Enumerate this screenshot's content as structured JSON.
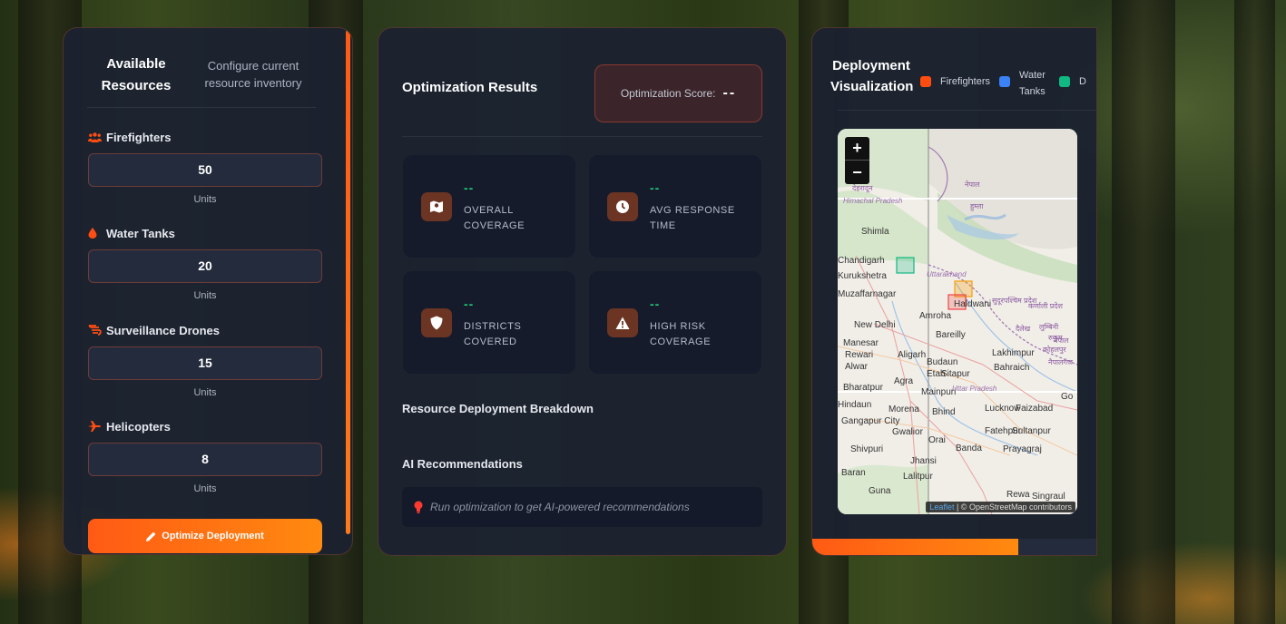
{
  "resources": {
    "title": "Available Resources",
    "subtitle": "Configure current resource inventory",
    "items": [
      {
        "label": "Firefighters",
        "value": "50",
        "unit": "Units",
        "icon": "people-icon"
      },
      {
        "label": "Water Tanks",
        "value": "20",
        "unit": "Units",
        "icon": "droplet-icon"
      },
      {
        "label": "Surveillance Drones",
        "value": "15",
        "unit": "Units",
        "icon": "drone-icon"
      },
      {
        "label": "Helicopters",
        "value": "8",
        "unit": "Units",
        "icon": "plane-icon"
      }
    ],
    "optimize_label": "Optimize Deployment"
  },
  "results": {
    "title": "Optimization Results",
    "score_label": "Optimization Score:",
    "score_value": "--",
    "stats": [
      {
        "value": "--",
        "label": "Overall Coverage",
        "icon": "map-icon"
      },
      {
        "value": "--",
        "label": "Avg Response Time",
        "icon": "clock-icon"
      },
      {
        "value": "--",
        "label": "Districts Covered",
        "icon": "shield-icon"
      },
      {
        "value": "--",
        "label": "High Risk Coverage",
        "icon": "warning-icon"
      }
    ],
    "breakdown_title": "Resource Deployment Breakdown",
    "ai_title": "AI Recommendations",
    "ai_placeholder": "Run optimization to get AI-powered recommendations"
  },
  "visualization": {
    "title": "Deployment Visualization",
    "legend": [
      {
        "label": "Firefighters",
        "color": "#ff4d12"
      },
      {
        "label": "Water Tanks",
        "color": "#3b82f6"
      },
      {
        "label": "D",
        "color": "#10b981"
      }
    ],
    "map": {
      "zoom_in": "+",
      "zoom_out": "−",
      "attribution_link": "Leaflet",
      "attribution_text": "| © OpenStreetMap contributors",
      "places": [
        "Shimla",
        "Chandigarh",
        "Kurukshetra",
        "Muzaffarnagar",
        "Uttarakhand",
        "Haldwani",
        "New Delhi",
        "Amroha",
        "Manesar",
        "Bareilly",
        "Lakhimpur",
        "Rewari",
        "Aligarh",
        "Budaun",
        "Etah",
        "Sitapur",
        "Bahraich",
        "Alwar",
        "Agra",
        "Bharatpur",
        "Mainpuri",
        "Uttar Pradesh",
        "Hindaun",
        "Morena",
        "Bhind",
        "Lucknow",
        "Faizabad",
        "Gangapur City",
        "Gwalior",
        "Orai",
        "Fatehpur",
        "Sultanpur",
        "Shivpuri",
        "Banda",
        "Prayagraj",
        "Jhansi",
        "Baran",
        "Lalitpur",
        "Guna",
        "Rewa",
        "Singraul",
        "Himachal Pradesh",
        "Go"
      ],
      "native_labels": [
        "नेपाल",
        "कर्णाली प्रदेश",
        "सुदूरपश्चिम प्रदेश",
        "लुम्बिनी",
        "दैलेख",
        "रुकुम",
        "कोहलपुर",
        "नैपालगंज",
        "देहरादून",
        "हुम्ला",
        "नेपाल"
      ]
    },
    "progress": 0.72,
    "progress_color": "#ff6a12"
  }
}
